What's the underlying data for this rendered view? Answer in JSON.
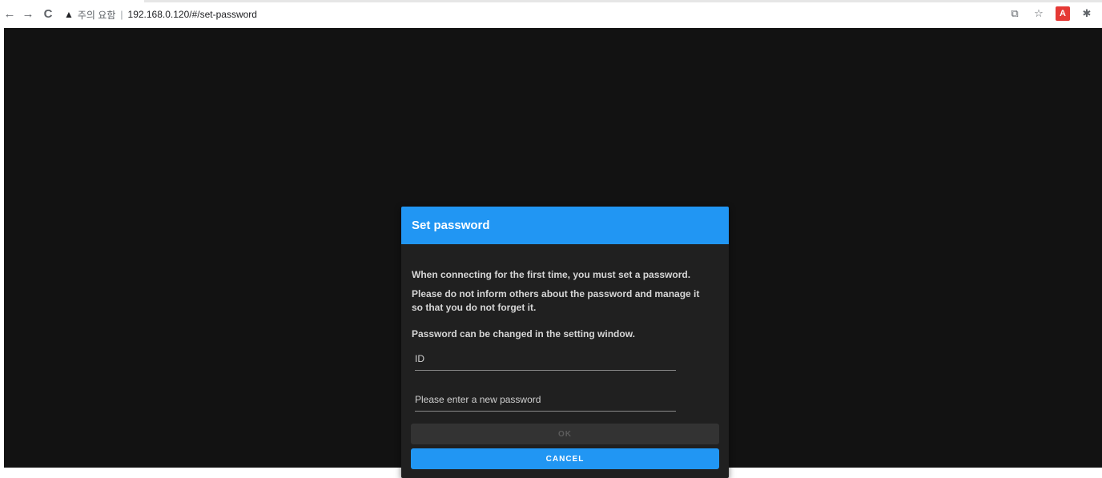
{
  "browser": {
    "back_icon": "←",
    "forward_icon": "→",
    "reload_icon": "C",
    "warning_icon": "▲",
    "security_text": "주의 요함",
    "separator": "|",
    "url": "192.168.0.120/#/set-password",
    "translate_icon": "⧉",
    "star_icon": "☆",
    "pdf_icon": "A",
    "extensions_icon": "✱"
  },
  "dialog": {
    "title": "Set password",
    "messages": [
      "When connecting for the first time, you must set a password.",
      "Please do not inform others about the password and manage it so that you do not forget it.",
      "Password can be changed in the setting window."
    ],
    "id_placeholder": "ID",
    "password_placeholder": "Please enter a new password",
    "ok_label": "OK",
    "cancel_label": "CANCEL"
  },
  "colors": {
    "accent": "#2196f3",
    "background": "#121212",
    "dialog_bg": "#202020"
  }
}
